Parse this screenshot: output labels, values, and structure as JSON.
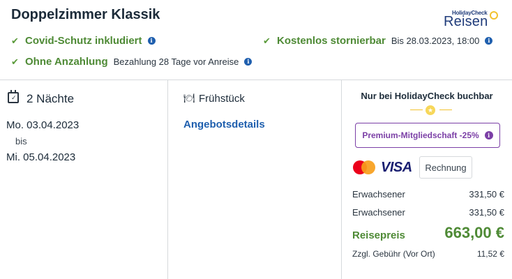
{
  "room": {
    "title": "Doppelzimmer Klassik"
  },
  "logo": {
    "small_text": "HolidayCheck",
    "big_text": "Reisen"
  },
  "features": [
    {
      "title": "Covid-Schutz inkludiert",
      "note": ""
    },
    {
      "title": "Kostenlos stornierbar",
      "note": "Bis 28.03.2023, 18:00"
    },
    {
      "title": "Ohne Anzahlung",
      "note": "Bezahlung 28 Tage vor Anreise"
    }
  ],
  "stay": {
    "nights": "2 Nächte",
    "from": "Mo. 03.04.2023",
    "bis": "bis",
    "to": "Mi. 05.04.2023"
  },
  "meal": {
    "label": "Frühstück",
    "offer_link": "Angebotsdetails"
  },
  "price": {
    "exclusive": "Nur bei HolidayCheck buchbar",
    "premium": "Premium-Mitgliedschaft -25%",
    "payment": {
      "visa": "VISA",
      "invoice": "Rechnung"
    },
    "rows": [
      {
        "label": "Erwachsener",
        "value": "331,50 €"
      },
      {
        "label": "Erwachsener",
        "value": "331,50 €"
      }
    ],
    "total_label": "Reisepreis",
    "total_value": "663,00 €",
    "fee_label": "Zzgl. Gebühr (Vor Ort)",
    "fee_value": "11,52 €"
  },
  "colors": {
    "green": "#4e8a35",
    "blue": "#1f5fae",
    "purple": "#7b3fa6",
    "gold": "#f2c230"
  }
}
